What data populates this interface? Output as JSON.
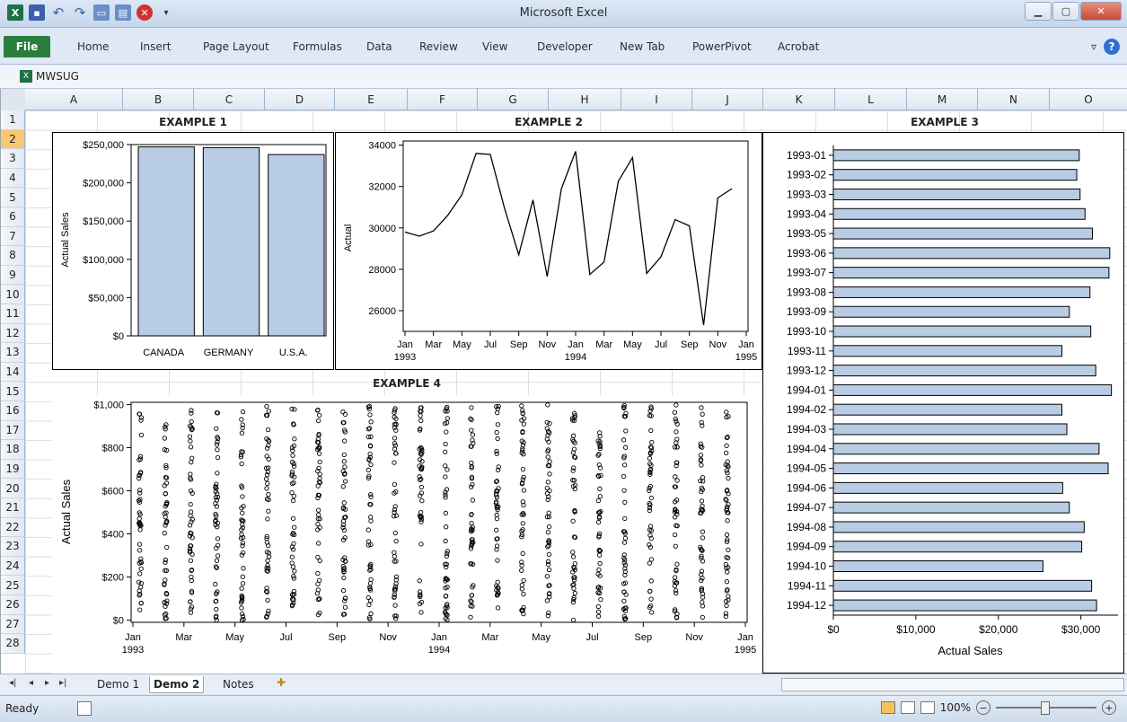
{
  "app": {
    "title": "Microsoft Excel",
    "workbook": "MWSUG"
  },
  "ribbon": {
    "file": "File",
    "tabs": [
      "Home",
      "Insert",
      "Page Layout",
      "Formulas",
      "Data",
      "Review",
      "View",
      "Developer",
      "New Tab",
      "PowerPivot",
      "Acrobat"
    ]
  },
  "columns": [
    "A",
    "B",
    "C",
    "D",
    "E",
    "F",
    "G",
    "H",
    "I",
    "J",
    "K",
    "L",
    "M",
    "N",
    "O"
  ],
  "rows": [
    "1",
    "2",
    "3",
    "4",
    "5",
    "6",
    "7",
    "8",
    "9",
    "10",
    "11",
    "12",
    "13",
    "14",
    "15",
    "16",
    "17",
    "18",
    "19",
    "20",
    "21",
    "22",
    "23",
    "24",
    "25",
    "26",
    "27",
    "28"
  ],
  "headings": {
    "ex1": "EXAMPLE 1",
    "ex2": "EXAMPLE 2",
    "ex3": "EXAMPLE 3",
    "ex4": "EXAMPLE 4"
  },
  "sheets": [
    "Demo 1",
    "Demo 2",
    "Notes"
  ],
  "status": {
    "ready": "Ready",
    "zoom": "100%"
  },
  "chart_data": [
    {
      "type": "bar",
      "title": "EXAMPLE 1",
      "categories": [
        "CANADA",
        "GERMANY",
        "U.S.A."
      ],
      "values": [
        247000,
        246000,
        237000
      ],
      "ylabel": "Actual Sales",
      "ylim": [
        0,
        250000
      ],
      "yticks": [
        "$0",
        "$50,000",
        "$100,000",
        "$150,000",
        "$200,000",
        "$250,000"
      ],
      "bar_color": "#b8cce4"
    },
    {
      "type": "line",
      "title": "EXAMPLE 2",
      "ylabel": "Actual",
      "ylim": [
        25000,
        34200
      ],
      "yticks": [
        "26000",
        "28000",
        "30000",
        "32000",
        "34000"
      ],
      "xticks": [
        "Jan",
        "Mar",
        "May",
        "Jul",
        "Sep",
        "Nov",
        "Jan",
        "Mar",
        "May",
        "Jul",
        "Sep",
        "Nov",
        "Jan"
      ],
      "xyears": [
        "1993",
        "1994",
        "1995"
      ],
      "x": [
        "1993-01",
        "1993-02",
        "1993-03",
        "1993-04",
        "1993-05",
        "1993-06",
        "1993-07",
        "1993-08",
        "1993-09",
        "1993-10",
        "1993-11",
        "1993-12",
        "1994-01",
        "1994-02",
        "1994-03",
        "1994-04",
        "1994-05",
        "1994-06",
        "1994-07",
        "1994-08",
        "1994-09",
        "1994-10",
        "1994-11",
        "1994-12"
      ],
      "values": [
        29800,
        29600,
        29850,
        30600,
        31600,
        33600,
        33550,
        30950,
        28700,
        31350,
        27650,
        31900,
        33700,
        27750,
        28350,
        32250,
        33400,
        27800,
        28600,
        30400,
        30100,
        25300,
        31450,
        31900
      ]
    },
    {
      "type": "bar",
      "orientation": "horizontal",
      "title": "EXAMPLE 3",
      "categories": [
        "1993-01",
        "1993-02",
        "1993-03",
        "1993-04",
        "1993-05",
        "1993-06",
        "1993-07",
        "1993-08",
        "1993-09",
        "1993-10",
        "1993-11",
        "1993-12",
        "1994-01",
        "1994-02",
        "1994-03",
        "1994-04",
        "1994-05",
        "1994-06",
        "1994-07",
        "1994-08",
        "1994-09",
        "1994-10",
        "1994-11",
        "1994-12"
      ],
      "values": [
        29800,
        29500,
        29900,
        30500,
        31400,
        33500,
        33400,
        31100,
        28600,
        31200,
        27700,
        31800,
        33700,
        27700,
        28300,
        32200,
        33300,
        27800,
        28600,
        30400,
        30100,
        25400,
        31300,
        31900
      ],
      "xlabel": "Actual Sales",
      "xlim": [
        0,
        34500
      ],
      "xticks": [
        "$0",
        "$10,000",
        "$20,000",
        "$30,000"
      ],
      "bar_color": "#b8cce4"
    },
    {
      "type": "scatter",
      "title": "EXAMPLE 4",
      "ylabel": "Actual Sales",
      "ylim": [
        0,
        1000
      ],
      "yticks": [
        "$0",
        "$200",
        "$400",
        "$600",
        "$800",
        "$1,000"
      ],
      "xticks": [
        "Jan",
        "Mar",
        "May",
        "Jul",
        "Sep",
        "Nov",
        "Jan",
        "Mar",
        "May",
        "Jul",
        "Sep",
        "Nov",
        "Jan"
      ],
      "xyears": [
        "1993",
        "1994",
        "1995"
      ],
      "months": [
        "1993-01",
        "1993-02",
        "1993-03",
        "1993-04",
        "1993-05",
        "1993-06",
        "1993-07",
        "1993-08",
        "1993-09",
        "1993-10",
        "1993-11",
        "1993-12",
        "1994-01",
        "1994-02",
        "1994-03",
        "1994-04",
        "1994-05",
        "1994-06",
        "1994-07",
        "1994-08",
        "1994-09",
        "1994-10",
        "1994-11",
        "1994-12"
      ],
      "note": "Many points per month spread uniformly between $0 and $1,000"
    }
  ]
}
